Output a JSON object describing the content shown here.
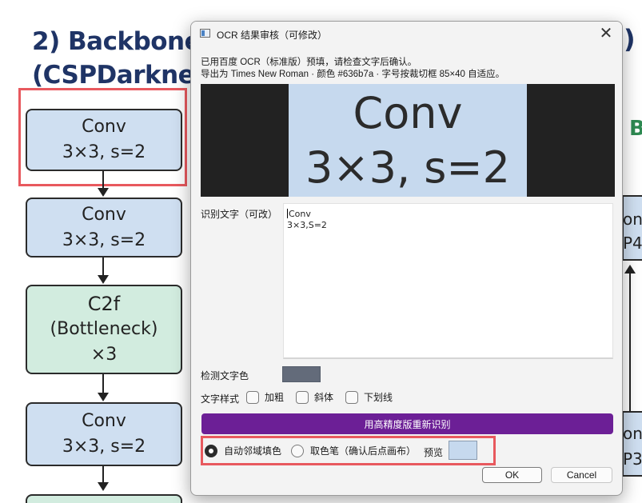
{
  "background": {
    "title_line1": "2) Backbone",
    "title_line2": "(CSPDarknet)",
    "blocks": [
      {
        "line1": "Conv",
        "line2": "3×3, s=2"
      },
      {
        "line1": "Conv",
        "line2": "3×3, s=2"
      },
      {
        "line1": "C2f",
        "line2": "(Bottleneck)",
        "line3": "×3"
      },
      {
        "line1": "Conv",
        "line2": "3×3, s=2"
      }
    ],
    "right_fragments": {
      "paren": ")",
      "b": "B",
      "conc_top": "onc",
      "p4": "P4",
      "conc_bottom": "onc",
      "p3": "P3"
    }
  },
  "dialog": {
    "title": "OCR 结果审核（可修改）",
    "close_glyph": "✕",
    "info_line1": "已用百度 OCR（标准版）预填，请检查文字后确认。",
    "info_line2": "导出为 Times New Roman · 颜色 #636b7a · 字号按裁切框 85×40 自适应。",
    "preview_text_line1": "Conv",
    "preview_text_line2": "3×3, s=2",
    "recognized_label": "识别文字（可改）",
    "recognized_lines": [
      "Conv",
      "3×3,S=2"
    ],
    "detected_color_label": "检测文字色",
    "detected_color": "#636b7a",
    "style_label": "文字样式",
    "bold_label": "加粗",
    "italic_label": "斜体",
    "underline_label": "下划线",
    "reocr_button": "用高精度版重新识别",
    "fill_auto_label": "自动邻域填色",
    "fill_picker_label": "取色笔（确认后点画布）",
    "preview_label": "预览",
    "fill_mode": "auto",
    "preview_color": "#c6d9ee",
    "ok_button": "OK",
    "cancel_button": "Cancel"
  }
}
